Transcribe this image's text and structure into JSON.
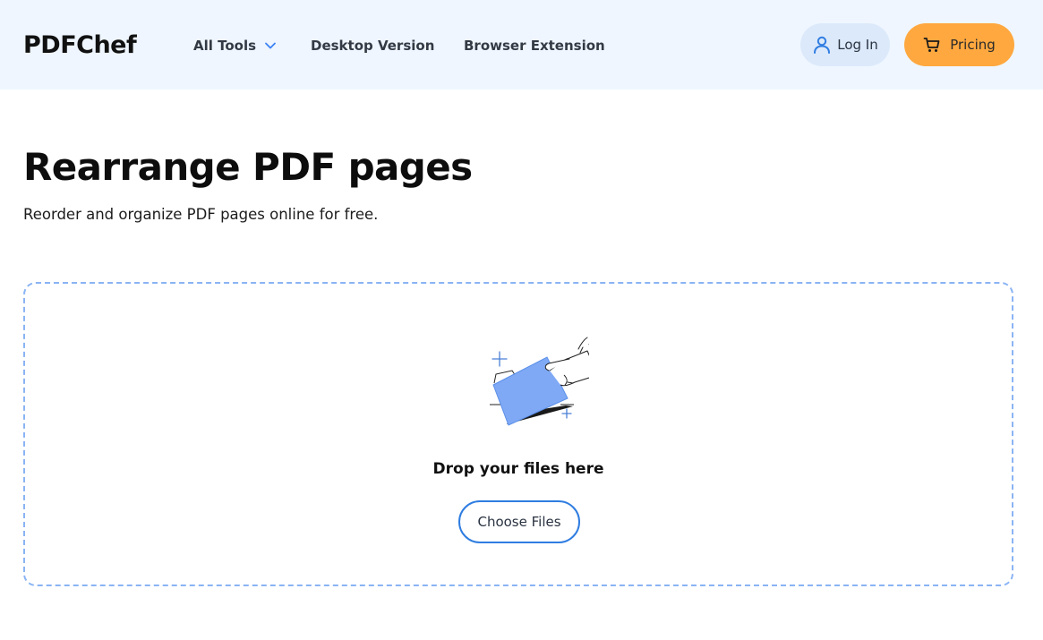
{
  "header": {
    "logo": "PDFChef",
    "nav": {
      "all_tools": "All Tools",
      "desktop": "Desktop Version",
      "extension": "Browser Extension"
    },
    "login": "Log In",
    "pricing": "Pricing"
  },
  "main": {
    "title": "Rearrange PDF pages",
    "subtitle": "Reorder and organize PDF pages online for free.",
    "dropzone": {
      "text": "Drop your files here",
      "button": "Choose Files"
    }
  },
  "colors": {
    "header_bg": "#eff6ff",
    "accent_blue": "#2f7de1",
    "pricing_orange": "#ffa83f",
    "dropzone_border": "#8ab4f4",
    "login_bg": "#dce9fb"
  },
  "icons": {
    "nav_chevron": "chevron-down-icon",
    "login": "user-icon",
    "pricing": "cart-icon",
    "dropzone": "hand-folder-illustration"
  }
}
